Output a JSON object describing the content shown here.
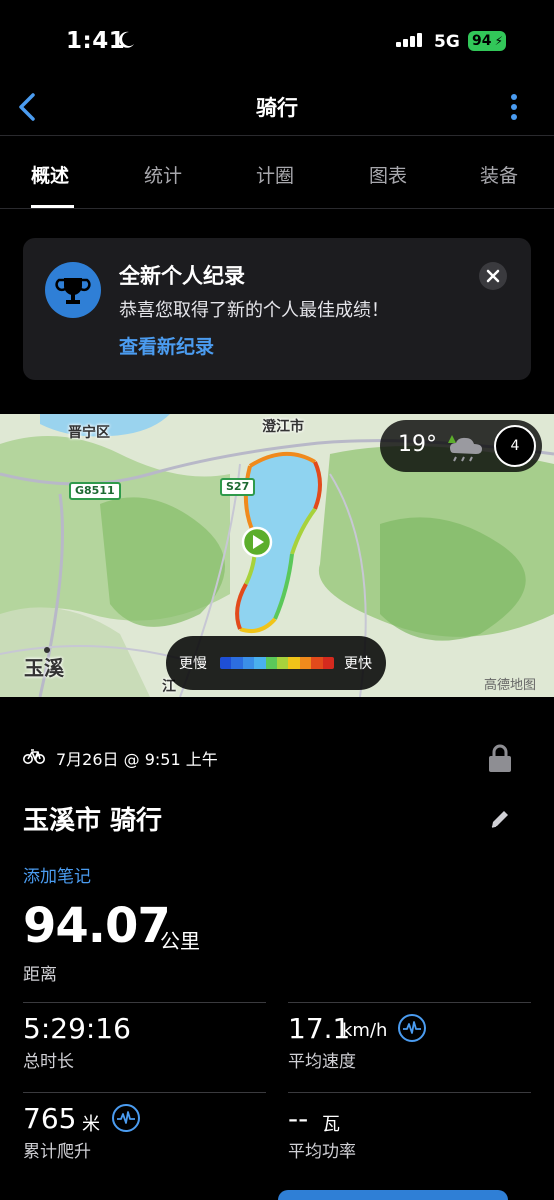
{
  "status_bar": {
    "time": "1:41",
    "network": "5G",
    "battery": "94"
  },
  "nav": {
    "title": "骑行"
  },
  "tabs": [
    {
      "label": "概述",
      "active": true
    },
    {
      "label": "统计",
      "active": false
    },
    {
      "label": "计圈",
      "active": false
    },
    {
      "label": "图表",
      "active": false
    },
    {
      "label": "装备",
      "active": false
    }
  ],
  "record_card": {
    "title": "全新个人纪录",
    "subtitle": "恭喜您取得了新的个人最佳成绩！",
    "link": "查看新纪录"
  },
  "map": {
    "labels": {
      "jinning": "晋宁区",
      "chengjiang": "澄江市",
      "yuxi": "玉溪",
      "jiang": "江"
    },
    "shields": {
      "g8511": "G8511",
      "s27": "S27"
    },
    "weather": {
      "temperature": "19°",
      "wind": "4"
    },
    "legend": {
      "slow": "更慢",
      "fast": "更快",
      "colors": [
        "#1e4fd6",
        "#2c6ee0",
        "#3b8fe8",
        "#4ab0ee",
        "#5bc85a",
        "#a7d23c",
        "#f0c419",
        "#f08a1c",
        "#e24a1b",
        "#d42a1e"
      ]
    },
    "credit": "高德地图"
  },
  "activity": {
    "date": "7月26日 @ 9:51 上午",
    "title": "玉溪市 骑行",
    "add_note": "添加笔记",
    "distance": {
      "value": "94.07",
      "unit": "公里",
      "label": "距离"
    },
    "duration": {
      "value": "5:29:16",
      "label": "总时长"
    },
    "avg_speed": {
      "value": "17.1",
      "unit": "km/h",
      "label": "平均速度"
    },
    "elevation": {
      "value": "765",
      "unit": "米",
      "label": "累计爬升"
    },
    "avg_power": {
      "value": "--",
      "unit": "瓦",
      "label": "平均功率"
    }
  },
  "colors": {
    "accent": "#4b9cf0",
    "battery": "#32c759",
    "background": "#000000",
    "card": "#1c1c1f"
  }
}
